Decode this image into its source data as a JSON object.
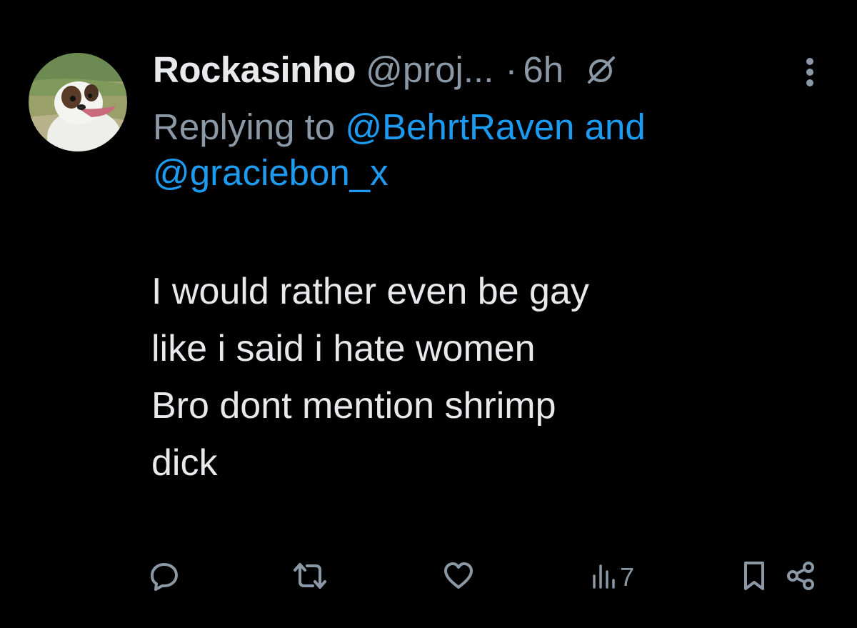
{
  "tweet": {
    "author": {
      "display_name": "Rockasinho",
      "handle": "@proj...",
      "avatar_icon": "dog-avatar"
    },
    "separator": "·",
    "time": "6h",
    "reply_prefix": "Replying to ",
    "reply_mention_1": "@BehrtRaven",
    "reply_connector": " and",
    "reply_mention_2": "@graciebon_x",
    "text_lines": [
      "I would rather even be gay",
      "like i said i hate women",
      "Bro dont mention shrimp",
      "dick"
    ],
    "actions": {
      "reply_icon": "reply-icon",
      "retweet_icon": "retweet-icon",
      "like_icon": "heart-icon",
      "views_icon": "views-icon",
      "views_count": "7",
      "bookmark_icon": "bookmark-icon",
      "share_icon": "share-icon"
    }
  },
  "colors": {
    "background": "#000000",
    "text": "#e7e9ea",
    "muted": "#8b98a5",
    "link": "#1d9bf0"
  }
}
